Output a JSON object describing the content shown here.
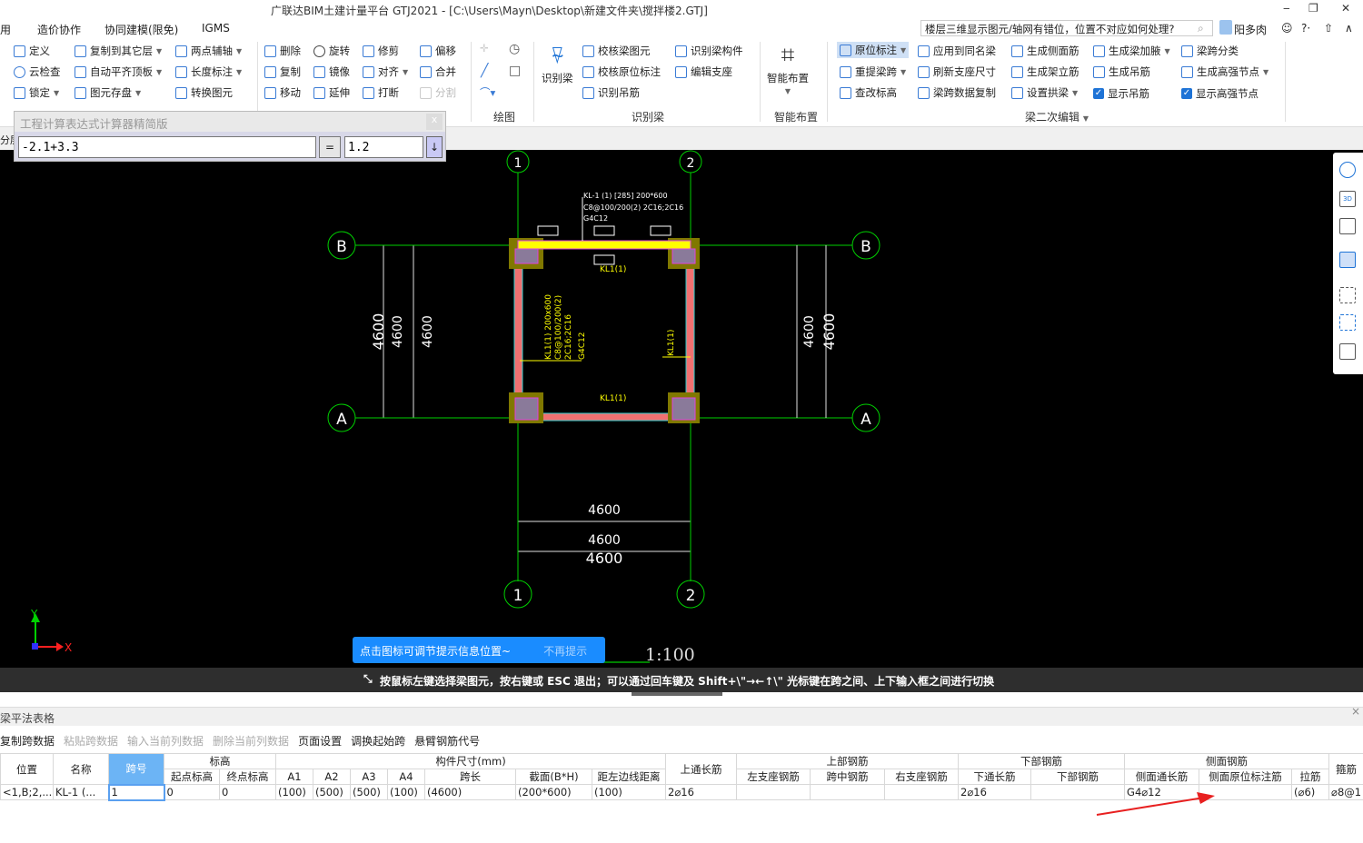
{
  "window": {
    "title": "广联达BIM土建计量平台 GTJ2021 - [C:\\Users\\Mayn\\Desktop\\新建文件夹\\搅拌楼2.GTJ]",
    "minimize": "‒",
    "restore": "❐",
    "close": "✕"
  },
  "menu": {
    "items": [
      "用",
      "造价协作",
      "协同建模(限免)",
      "IGMS"
    ],
    "search_value": "楼层三维显示图元/轴网有错位，位置不对应如何处理?",
    "user": "阳多肉",
    "help": "?·"
  },
  "ribbon": {
    "general": {
      "items": [
        "定义",
        "云检查",
        "锁定",
        "复制到其它层",
        "自动平齐顶板",
        "图元存盘",
        "两点辅轴",
        "长度标注",
        "转换图元"
      ]
    },
    "modify": {
      "items": [
        "删除",
        "旋转",
        "修剪",
        "偏移",
        "复制",
        "镜像",
        "对齐",
        "合并",
        "移动",
        "延伸",
        "打断",
        "分割"
      ]
    },
    "draw": {
      "label": "绘图"
    },
    "identify": {
      "big": "识别梁",
      "items": [
        "校核梁图元",
        "校核原位标注",
        "识别吊筋",
        "识别梁构件",
        "编辑支座"
      ],
      "label": "识别梁"
    },
    "smart": {
      "big": "智能布置",
      "label": "智能布置"
    },
    "secondary": {
      "items": [
        "原位标注",
        "重提梁跨",
        "查改标高",
        "应用到同名梁",
        "刷新支座尺寸",
        "梁跨数据复制",
        "生成侧面筋",
        "生成架立筋",
        "设置拱梁",
        "生成梁加腋",
        "生成吊筋",
        "显示吊筋",
        "梁跨分类",
        "生成高强节点",
        "显示高强节点"
      ],
      "show_hanger_checked": true,
      "show_node_checked": true,
      "label": "梁二次编辑"
    }
  },
  "layer_tab": "分层",
  "calculator": {
    "title": "工程计算表达式计算器精简版",
    "close": "x",
    "expression": "-2.1+3.3",
    "equals": "=",
    "result": "1.2",
    "down": "↓"
  },
  "cad": {
    "axes": {
      "top": [
        "1",
        "2"
      ],
      "bottom": [
        "1",
        "2"
      ],
      "left": [
        "B",
        "A"
      ],
      "right": [
        "B",
        "A"
      ]
    },
    "beam_label": [
      "KL-1 (1) [285] 200*600",
      "C8@100/200(2) 2C16;2C16",
      "G4C12"
    ],
    "span_labels": [
      "KL1(1)",
      "KL1(1)",
      "KL1(1)"
    ],
    "left_beam_label": [
      "KL1(1) 200x600",
      "C8@100/200(2)",
      "2C16;2C16",
      "G4C12"
    ],
    "dims": [
      "4600",
      "4600",
      "4600",
      "4600",
      "4600",
      "4600",
      "4600",
      "4600"
    ],
    "scale": "1:100",
    "ucs": {
      "y": "Y",
      "x": "X"
    },
    "colors": {
      "grid": "#00d000",
      "beam": "#ffff00",
      "beam_side": "#f07070",
      "column": "#807800"
    }
  },
  "tooltip": {
    "text": "点击图标可调节提示信息位置~",
    "dismiss": "不再提示"
  },
  "status": {
    "text": "按鼠标左键选择梁图元，按右键或 ESC 退出；可以通过回车键及 Shift+\\\"→←↑\\\" 光标键在跨之间、上下输入框之间进行切换"
  },
  "panel": {
    "title": "梁平法表格",
    "close": "×",
    "toolbar": [
      {
        "label": "复制跨数据",
        "enabled": true
      },
      {
        "label": "粘贴跨数据",
        "enabled": false
      },
      {
        "label": "输入当前列数据",
        "enabled": false
      },
      {
        "label": "删除当前列数据",
        "enabled": false
      },
      {
        "label": "页面设置",
        "enabled": true
      },
      {
        "label": "调换起始跨",
        "enabled": true
      },
      {
        "label": "悬臂钢筋代号",
        "enabled": true
      }
    ],
    "groups": {
      "elev": "标高",
      "size": "构件尺寸(mm)",
      "top": "上部钢筋",
      "bottom": "下部钢筋",
      "side": "侧面钢筋"
    },
    "columns": [
      "位置",
      "名称",
      "跨号",
      "起点标高",
      "终点标高",
      "A1",
      "A2",
      "A3",
      "A4",
      "跨长",
      "截面(B*H)",
      "距左边线距离",
      "上通长筋",
      "左支座钢筋",
      "跨中钢筋",
      "右支座钢筋",
      "下通长筋",
      "下部钢筋",
      "侧面通长筋",
      "侧面原位标注筋",
      "拉筋",
      "箍筋"
    ],
    "rows": [
      [
        "<1,B;2,...",
        "KL-1 (...",
        "1",
        "0",
        "0",
        "(100)",
        "(500)",
        "(500)",
        "(100)",
        "(4600)",
        "(200*600)",
        "(100)",
        "2⌀16",
        "",
        "",
        "",
        "2⌀16",
        "",
        "G4⌀12",
        "",
        "(⌀6)",
        "⌀8@1"
      ]
    ]
  }
}
